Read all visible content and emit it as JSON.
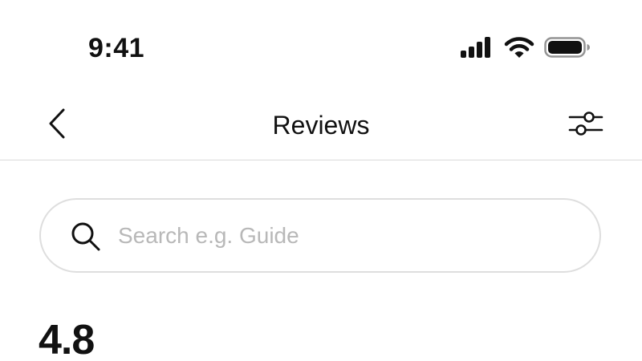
{
  "status_bar": {
    "time": "9:41",
    "icons": [
      "signal-icon",
      "wifi-icon",
      "battery-icon"
    ]
  },
  "nav": {
    "title": "Reviews",
    "back_icon": "chevron-left-icon",
    "filter_icon": "sliders-icon"
  },
  "search": {
    "placeholder": "Search e.g. Guide",
    "value": "",
    "icon": "search-icon"
  },
  "rating": {
    "value": "4.8"
  },
  "colors": {
    "text": "#111111",
    "placeholder": "#b8b8b8",
    "border": "#dedede",
    "divider": "#d9d9d9",
    "background": "#ffffff"
  }
}
